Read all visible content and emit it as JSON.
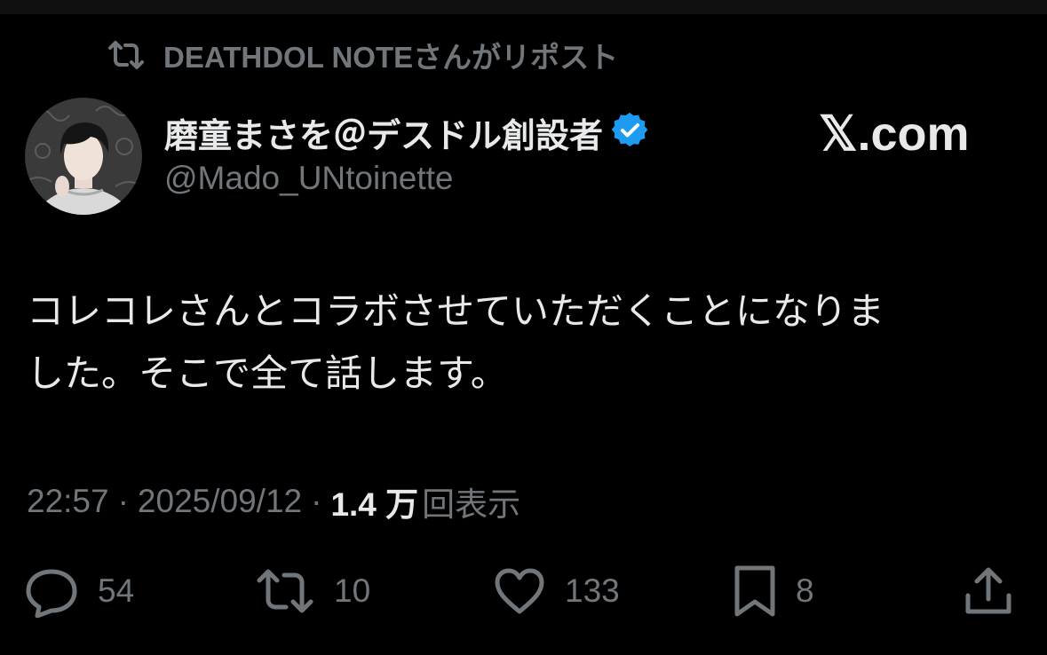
{
  "repost": {
    "icon": "repost-icon",
    "text": "DEATHDOL NOTEさんがリポスト"
  },
  "author": {
    "display_name": "磨童まさを＠デスドル創設者",
    "verified_icon": "verified-badge-icon",
    "verified_color": "#1d9bf0",
    "handle": "@Mado_UNtoinette"
  },
  "brand": {
    "label": "𝕏.com"
  },
  "tweet": {
    "lines": [
      "コレコレさんとコラボさせていただくことになりま",
      "した。そこで全て話します。"
    ]
  },
  "meta": {
    "time": "22:57",
    "separator": "·",
    "date": "2025/09/12",
    "views_count": "1.4 万",
    "views_label": "回表示"
  },
  "actions": {
    "reply": {
      "icon": "reply-icon",
      "count": "54"
    },
    "retweet": {
      "icon": "retweet-icon",
      "count": "10"
    },
    "like": {
      "icon": "heart-icon",
      "count": "133"
    },
    "bookmark": {
      "icon": "bookmark-icon",
      "count": "8"
    },
    "share": {
      "icon": "share-icon"
    }
  },
  "colors": {
    "background": "#000000",
    "text_primary": "#e7e9ea",
    "text_secondary": "#71767b",
    "accent": "#1d9bf0"
  }
}
